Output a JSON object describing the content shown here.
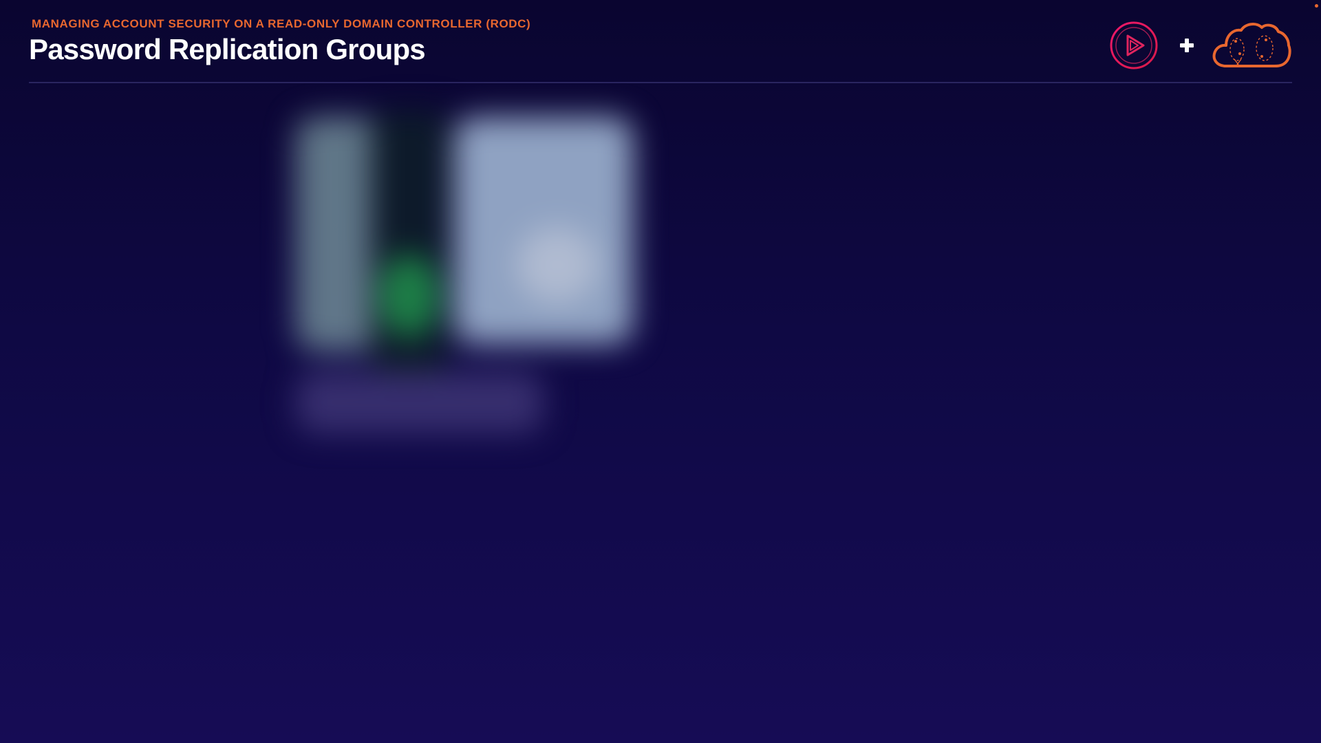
{
  "header": {
    "course_subtitle": "MANAGING ACCOUNT SECURITY ON A READ-ONLY DOMAIN CONTROLLER (RODC)",
    "slide_title": "Password Replication Groups"
  },
  "logos": {
    "left_logo_icon": "pluralsight-play-icon",
    "separator_icon": "plus-icon",
    "right_logo_icon": "cloud-brain-icon"
  },
  "colors": {
    "background_top": "#0a0530",
    "background_bottom": "#160c55",
    "accent_orange": "#e8672f",
    "accent_pink": "#e0245e",
    "title_white": "#ffffff"
  }
}
